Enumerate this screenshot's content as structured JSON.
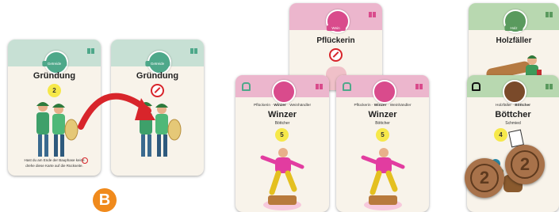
{
  "colors": {
    "getreide": "#4ea88a",
    "wein": "#d94b8c",
    "holz": "#5a9a5e",
    "coin": "#f6e84a",
    "badge": "#f08a1c",
    "pin": "#d8252b",
    "arrow": "#d8252b"
  },
  "card1": {
    "category": "Getreide",
    "title": "Gründung",
    "coin": "2",
    "footer_line1": "Hast du am Ende der Bauphase keine",
    "footer_line2": "drehe diese Karte auf die Rückseite."
  },
  "card2": {
    "category": "Getreide",
    "title": "Gründung"
  },
  "badge": {
    "letter": "B"
  },
  "card_pflueckerin": {
    "category": "Wein",
    "title": "Pflückerin"
  },
  "card_winzer1": {
    "chain_left": "Pflückerin · ",
    "chain_mid": "Winzer",
    "chain_right": " · Weinhändler",
    "title": "Winzer",
    "sub": "Böttcher",
    "coin": "5"
  },
  "card_winzer2": {
    "chain_left": "Pflückerin · ",
    "chain_mid": "Winzer",
    "chain_right": " · Weinhändler",
    "title": "Winzer",
    "sub": "Böttcher",
    "coin": "5"
  },
  "card_holz": {
    "category": "Holz",
    "title": "Holzfäller"
  },
  "card_boettcher": {
    "chain_left": "Holzfäller · ",
    "chain_mid": "Böttcher",
    "title": "Böttcher",
    "sub": "Schmied",
    "coin": "4"
  },
  "tokens": [
    {
      "value": "2"
    },
    {
      "value": "2"
    }
  ]
}
